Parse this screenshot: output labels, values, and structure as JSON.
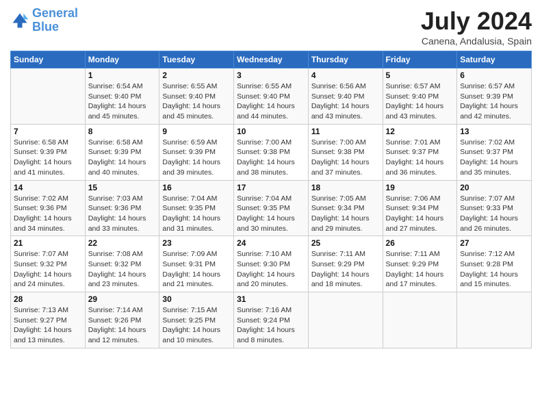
{
  "logo": {
    "line1": "General",
    "line2": "Blue"
  },
  "title": "July 2024",
  "location": "Canena, Andalusia, Spain",
  "weekdays": [
    "Sunday",
    "Monday",
    "Tuesday",
    "Wednesday",
    "Thursday",
    "Friday",
    "Saturday"
  ],
  "weeks": [
    [
      {
        "day": "",
        "sunrise": "",
        "sunset": "",
        "daylight": ""
      },
      {
        "day": "1",
        "sunrise": "Sunrise: 6:54 AM",
        "sunset": "Sunset: 9:40 PM",
        "daylight": "Daylight: 14 hours and 45 minutes."
      },
      {
        "day": "2",
        "sunrise": "Sunrise: 6:55 AM",
        "sunset": "Sunset: 9:40 PM",
        "daylight": "Daylight: 14 hours and 45 minutes."
      },
      {
        "day": "3",
        "sunrise": "Sunrise: 6:55 AM",
        "sunset": "Sunset: 9:40 PM",
        "daylight": "Daylight: 14 hours and 44 minutes."
      },
      {
        "day": "4",
        "sunrise": "Sunrise: 6:56 AM",
        "sunset": "Sunset: 9:40 PM",
        "daylight": "Daylight: 14 hours and 43 minutes."
      },
      {
        "day": "5",
        "sunrise": "Sunrise: 6:57 AM",
        "sunset": "Sunset: 9:40 PM",
        "daylight": "Daylight: 14 hours and 43 minutes."
      },
      {
        "day": "6",
        "sunrise": "Sunrise: 6:57 AM",
        "sunset": "Sunset: 9:39 PM",
        "daylight": "Daylight: 14 hours and 42 minutes."
      }
    ],
    [
      {
        "day": "7",
        "sunrise": "Sunrise: 6:58 AM",
        "sunset": "Sunset: 9:39 PM",
        "daylight": "Daylight: 14 hours and 41 minutes."
      },
      {
        "day": "8",
        "sunrise": "Sunrise: 6:58 AM",
        "sunset": "Sunset: 9:39 PM",
        "daylight": "Daylight: 14 hours and 40 minutes."
      },
      {
        "day": "9",
        "sunrise": "Sunrise: 6:59 AM",
        "sunset": "Sunset: 9:39 PM",
        "daylight": "Daylight: 14 hours and 39 minutes."
      },
      {
        "day": "10",
        "sunrise": "Sunrise: 7:00 AM",
        "sunset": "Sunset: 9:38 PM",
        "daylight": "Daylight: 14 hours and 38 minutes."
      },
      {
        "day": "11",
        "sunrise": "Sunrise: 7:00 AM",
        "sunset": "Sunset: 9:38 PM",
        "daylight": "Daylight: 14 hours and 37 minutes."
      },
      {
        "day": "12",
        "sunrise": "Sunrise: 7:01 AM",
        "sunset": "Sunset: 9:37 PM",
        "daylight": "Daylight: 14 hours and 36 minutes."
      },
      {
        "day": "13",
        "sunrise": "Sunrise: 7:02 AM",
        "sunset": "Sunset: 9:37 PM",
        "daylight": "Daylight: 14 hours and 35 minutes."
      }
    ],
    [
      {
        "day": "14",
        "sunrise": "Sunrise: 7:02 AM",
        "sunset": "Sunset: 9:36 PM",
        "daylight": "Daylight: 14 hours and 34 minutes."
      },
      {
        "day": "15",
        "sunrise": "Sunrise: 7:03 AM",
        "sunset": "Sunset: 9:36 PM",
        "daylight": "Daylight: 14 hours and 33 minutes."
      },
      {
        "day": "16",
        "sunrise": "Sunrise: 7:04 AM",
        "sunset": "Sunset: 9:35 PM",
        "daylight": "Daylight: 14 hours and 31 minutes."
      },
      {
        "day": "17",
        "sunrise": "Sunrise: 7:04 AM",
        "sunset": "Sunset: 9:35 PM",
        "daylight": "Daylight: 14 hours and 30 minutes."
      },
      {
        "day": "18",
        "sunrise": "Sunrise: 7:05 AM",
        "sunset": "Sunset: 9:34 PM",
        "daylight": "Daylight: 14 hours and 29 minutes."
      },
      {
        "day": "19",
        "sunrise": "Sunrise: 7:06 AM",
        "sunset": "Sunset: 9:34 PM",
        "daylight": "Daylight: 14 hours and 27 minutes."
      },
      {
        "day": "20",
        "sunrise": "Sunrise: 7:07 AM",
        "sunset": "Sunset: 9:33 PM",
        "daylight": "Daylight: 14 hours and 26 minutes."
      }
    ],
    [
      {
        "day": "21",
        "sunrise": "Sunrise: 7:07 AM",
        "sunset": "Sunset: 9:32 PM",
        "daylight": "Daylight: 14 hours and 24 minutes."
      },
      {
        "day": "22",
        "sunrise": "Sunrise: 7:08 AM",
        "sunset": "Sunset: 9:32 PM",
        "daylight": "Daylight: 14 hours and 23 minutes."
      },
      {
        "day": "23",
        "sunrise": "Sunrise: 7:09 AM",
        "sunset": "Sunset: 9:31 PM",
        "daylight": "Daylight: 14 hours and 21 minutes."
      },
      {
        "day": "24",
        "sunrise": "Sunrise: 7:10 AM",
        "sunset": "Sunset: 9:30 PM",
        "daylight": "Daylight: 14 hours and 20 minutes."
      },
      {
        "day": "25",
        "sunrise": "Sunrise: 7:11 AM",
        "sunset": "Sunset: 9:29 PM",
        "daylight": "Daylight: 14 hours and 18 minutes."
      },
      {
        "day": "26",
        "sunrise": "Sunrise: 7:11 AM",
        "sunset": "Sunset: 9:29 PM",
        "daylight": "Daylight: 14 hours and 17 minutes."
      },
      {
        "day": "27",
        "sunrise": "Sunrise: 7:12 AM",
        "sunset": "Sunset: 9:28 PM",
        "daylight": "Daylight: 14 hours and 15 minutes."
      }
    ],
    [
      {
        "day": "28",
        "sunrise": "Sunrise: 7:13 AM",
        "sunset": "Sunset: 9:27 PM",
        "daylight": "Daylight: 14 hours and 13 minutes."
      },
      {
        "day": "29",
        "sunrise": "Sunrise: 7:14 AM",
        "sunset": "Sunset: 9:26 PM",
        "daylight": "Daylight: 14 hours and 12 minutes."
      },
      {
        "day": "30",
        "sunrise": "Sunrise: 7:15 AM",
        "sunset": "Sunset: 9:25 PM",
        "daylight": "Daylight: 14 hours and 10 minutes."
      },
      {
        "day": "31",
        "sunrise": "Sunrise: 7:16 AM",
        "sunset": "Sunset: 9:24 PM",
        "daylight": "Daylight: 14 hours and 8 minutes."
      },
      {
        "day": "",
        "sunrise": "",
        "sunset": "",
        "daylight": ""
      },
      {
        "day": "",
        "sunrise": "",
        "sunset": "",
        "daylight": ""
      },
      {
        "day": "",
        "sunrise": "",
        "sunset": "",
        "daylight": ""
      }
    ]
  ]
}
